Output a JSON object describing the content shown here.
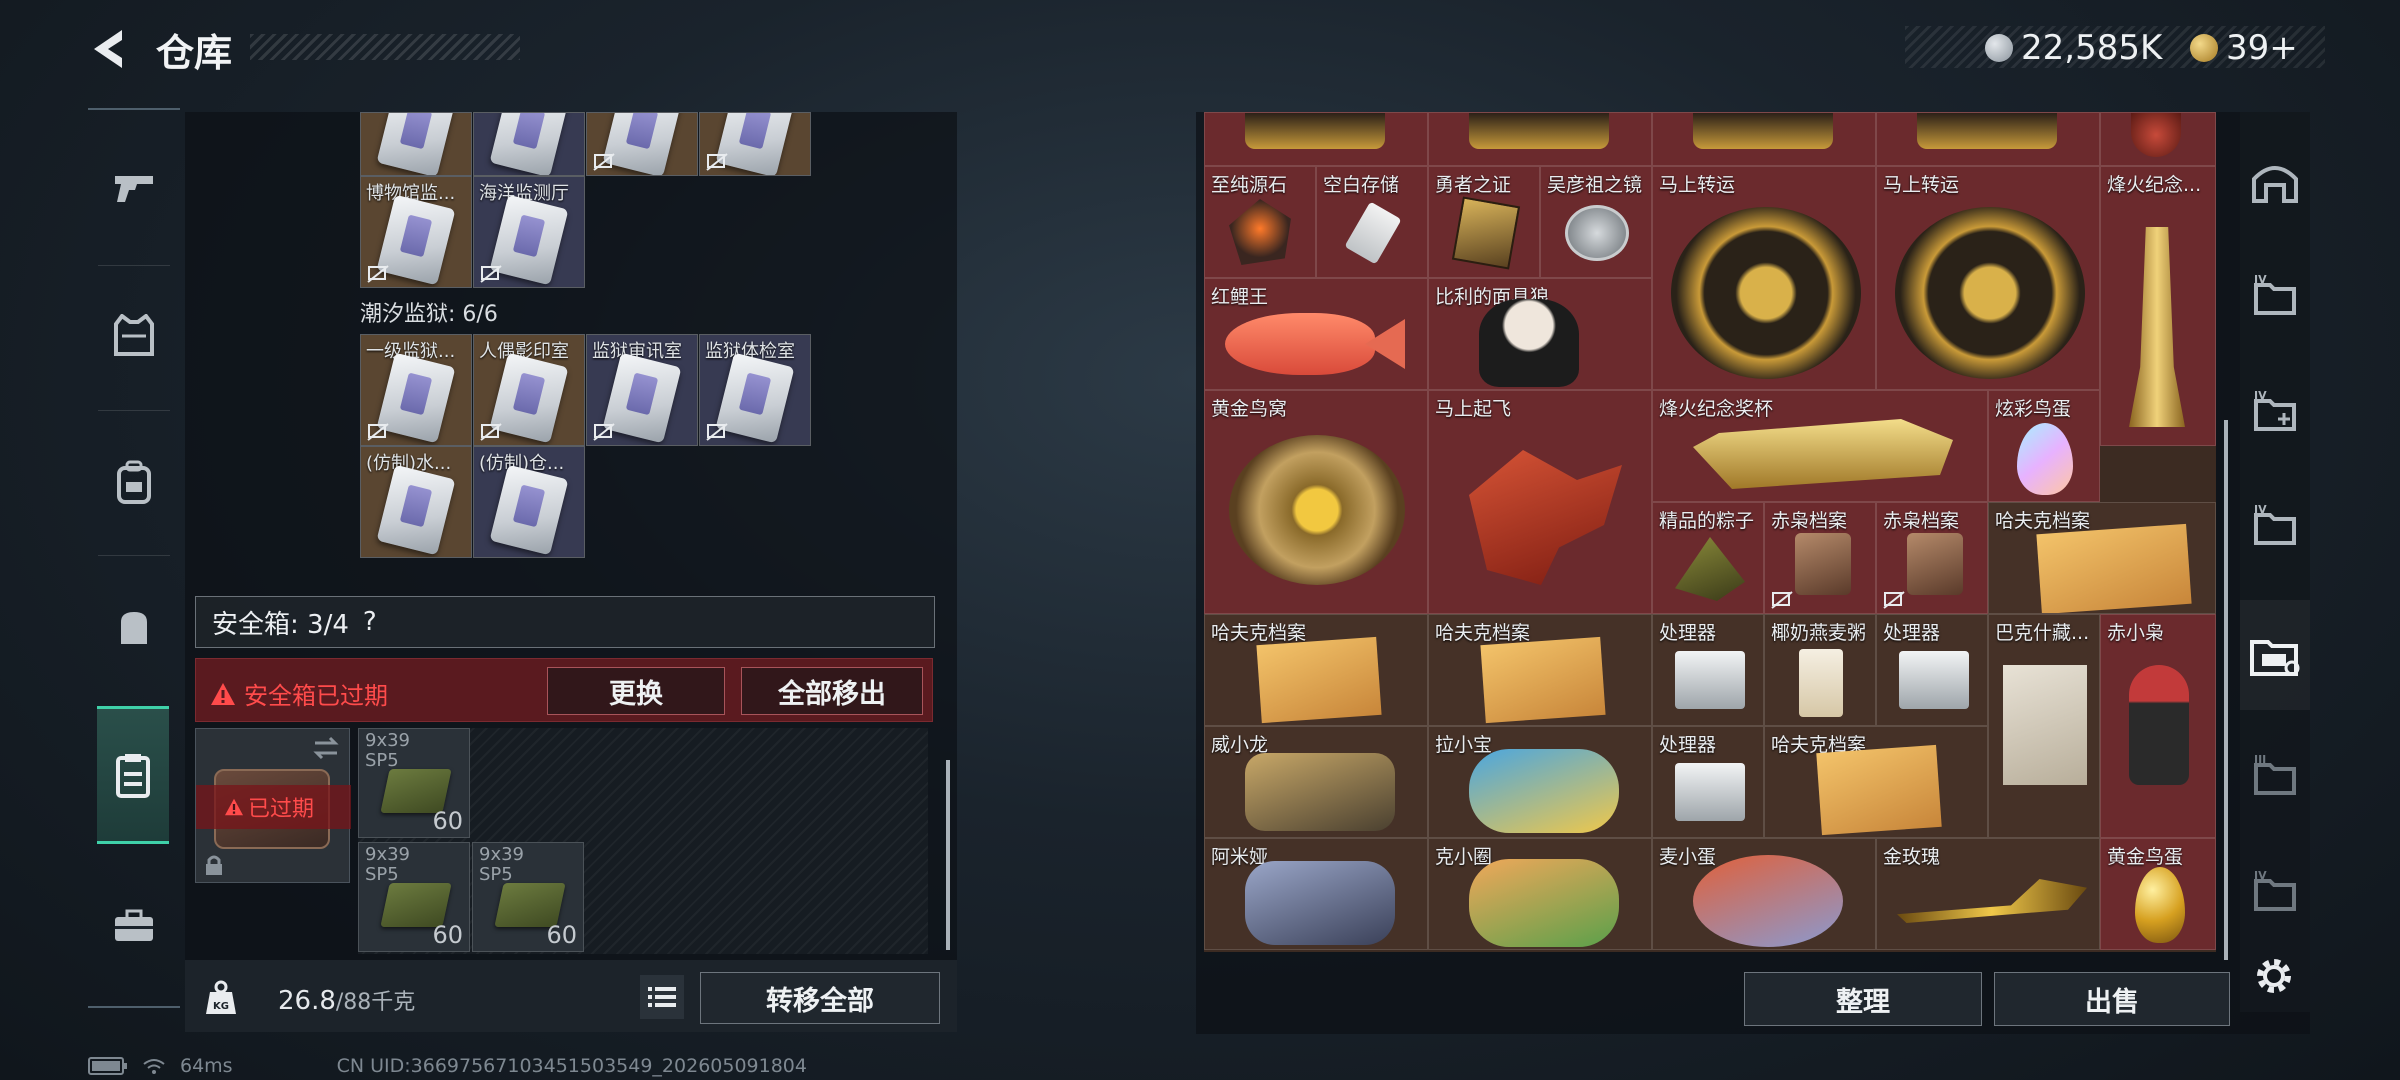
{
  "header": {
    "title": "仓库",
    "hafcoin": "22,585K",
    "tokens": "39+"
  },
  "left_grid": {
    "partial_labels": [
      "",
      "",
      "",
      ""
    ],
    "row1": [
      {
        "label": "博物馆监...",
        "bg": "orange",
        "locked": true
      },
      {
        "label": "海洋监测厅",
        "bg": "purple",
        "locked": true
      }
    ],
    "prison_title": "潮汐监狱: 6/6",
    "prison_items": [
      {
        "label": "一级监狱...",
        "bg": "orange"
      },
      {
        "label": "人偶影印室",
        "bg": "orange"
      },
      {
        "label": "监狱审讯室",
        "bg": "purple"
      },
      {
        "label": "监狱体检室",
        "bg": "purple"
      },
      {
        "label": "(仿制)水...",
        "bg": "orange"
      },
      {
        "label": "(仿制)仓...",
        "bg": "purple"
      }
    ]
  },
  "safebox": {
    "label": "安全箱: 3/4",
    "help": "?",
    "expired_warning": "安全箱已过期",
    "replace_label": "更换",
    "move_all_label": "全部移出",
    "slot_expired": "已过期",
    "ammo": [
      {
        "line1": "9x39",
        "line2": "SP5",
        "qty": "60"
      },
      {
        "line1": "9x39",
        "line2": "SP5",
        "qty": "60"
      },
      {
        "line1": "9x39",
        "line2": "SP5",
        "qty": "60"
      }
    ]
  },
  "weight": {
    "current": "26.8",
    "max": "/88千克",
    "transfer_label": "转移全部"
  },
  "right_grid": {
    "items": [
      {
        "label": "至纯源石"
      },
      {
        "label": "空白存储"
      },
      {
        "label": "勇者之证"
      },
      {
        "label": "吴彦祖之镜"
      },
      {
        "label": "马上转运"
      },
      {
        "label": "马上转运"
      },
      {
        "label": "烽火纪念..."
      },
      {
        "label": "红鲤王"
      },
      {
        "label": "比利的面具狼"
      },
      {
        "label": "黄金鸟窝"
      },
      {
        "label": "马上起飞"
      },
      {
        "label": "烽火纪念奖杯"
      },
      {
        "label": "炫彩鸟蛋"
      },
      {
        "label": "精品的粽子"
      },
      {
        "label": "赤枭档案"
      },
      {
        "label": "赤枭档案"
      },
      {
        "label": "哈夫克档案"
      },
      {
        "label": "哈夫克档案"
      },
      {
        "label": "哈夫克档案"
      },
      {
        "label": "处理器"
      },
      {
        "label": "椰奶燕麦粥"
      },
      {
        "label": "处理器"
      },
      {
        "label": "巴克什藏..."
      },
      {
        "label": "赤小枭"
      },
      {
        "label": "威小龙"
      },
      {
        "label": "拉小宝"
      },
      {
        "label": "处理器"
      },
      {
        "label": "哈夫克档案"
      },
      {
        "label": "阿米娅"
      },
      {
        "label": "克小圈"
      },
      {
        "label": "麦小蛋"
      },
      {
        "label": "金玫瑰"
      },
      {
        "label": "黄金鸟蛋"
      }
    ],
    "sort_label": "整理",
    "sell_label": "出售"
  },
  "status": {
    "ping": "64ms",
    "uid": "CN UID:36697567103451503549_202605091804"
  },
  "colors": {
    "accent": "#3fd1a9",
    "danger": "#ff4b4b",
    "red_tile": "#6b2a2d",
    "brown_tile": "#453127"
  }
}
